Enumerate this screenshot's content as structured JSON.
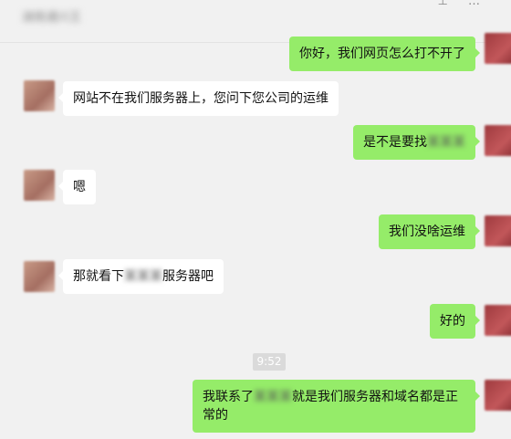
{
  "header": {
    "contact_name": "湖南通兴王"
  },
  "window_controls": {
    "pin": "⊥",
    "more": "…"
  },
  "messages": [
    {
      "side": "out",
      "text": "你好，我们网页怎么打不开了"
    },
    {
      "side": "in",
      "text": "网站不在我们服务器上，您问下您公司的运维"
    },
    {
      "side": "out",
      "text_before": "是不是要找",
      "redacted": "某某某"
    },
    {
      "side": "in",
      "text": "嗯"
    },
    {
      "side": "out",
      "text": "我们没啥运维"
    },
    {
      "side": "in",
      "text_before": "那就看下",
      "redacted": "某某某",
      "text_after": "服务器吧"
    },
    {
      "side": "out",
      "text": "好的"
    },
    {
      "side": "out",
      "text_before": "我联系了",
      "redacted": "某某某",
      "text_after": "就是我们服务器和域名都是正常的"
    }
  ],
  "timestamp": "9:52",
  "colors": {
    "outgoing_bubble": "#95ec69",
    "incoming_bubble": "#ffffff",
    "background": "#f1f1f1"
  }
}
